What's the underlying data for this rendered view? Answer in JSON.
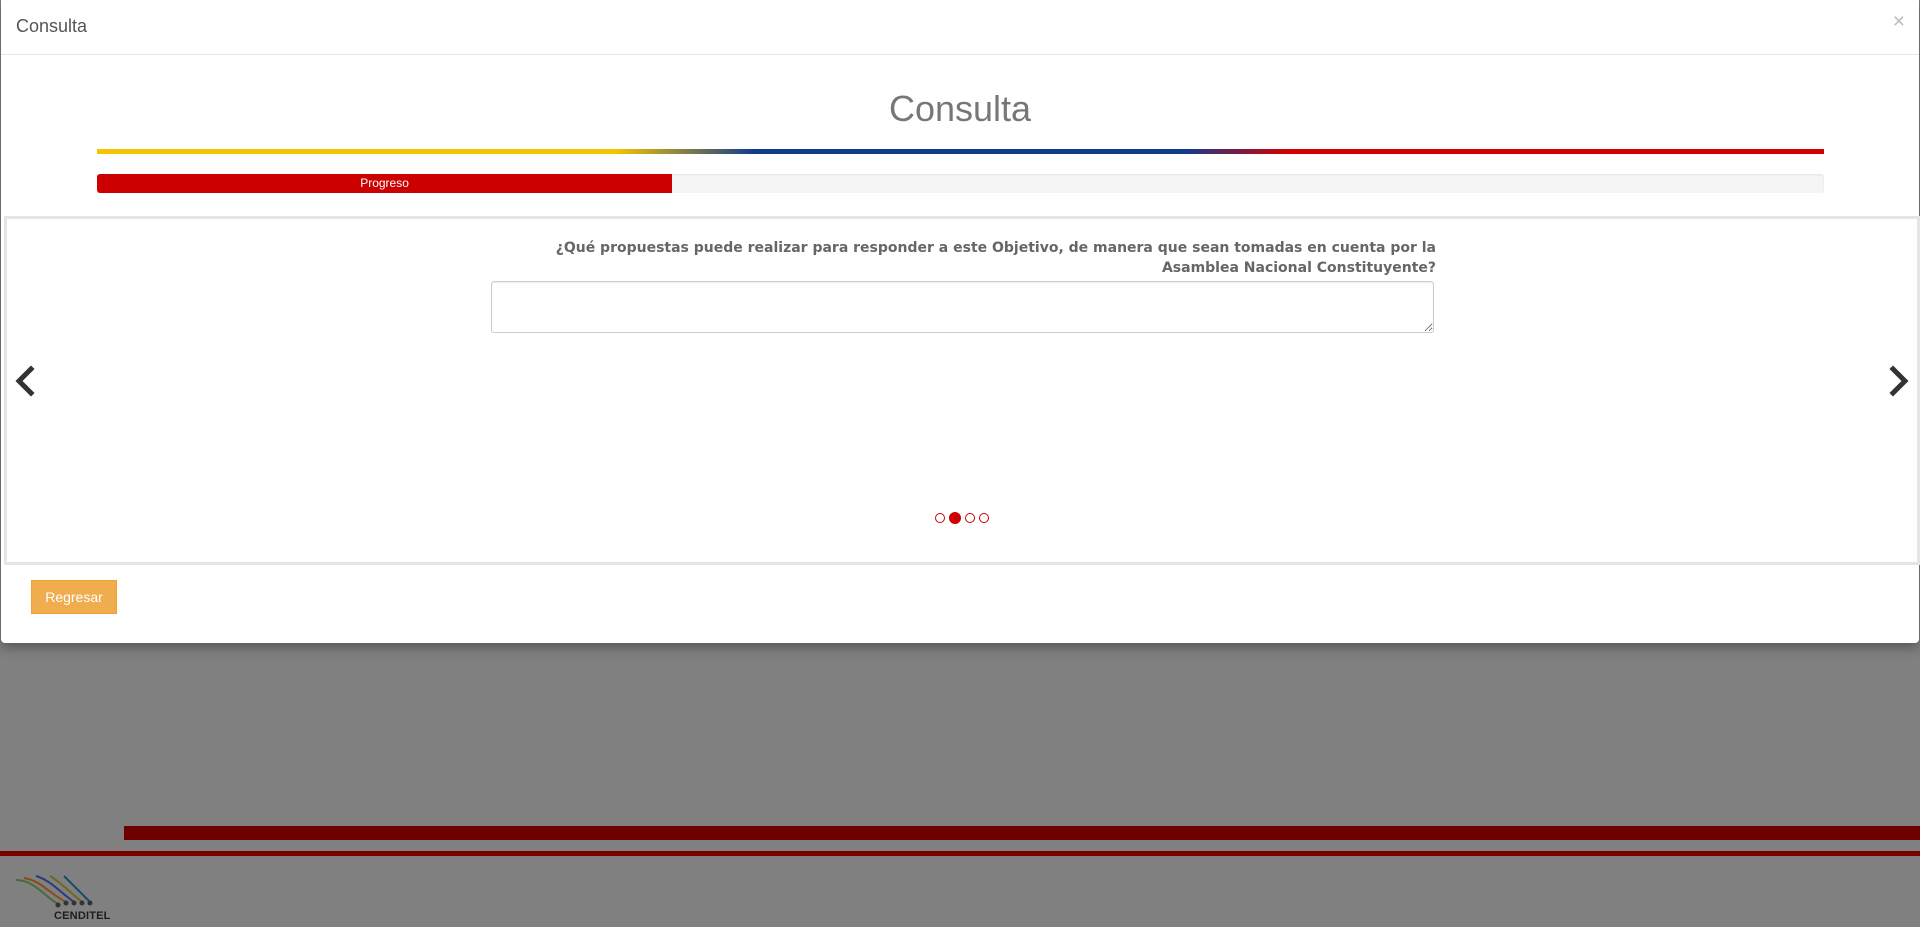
{
  "modal": {
    "header_title": "Consulta",
    "close_symbol": "×",
    "title": "Consulta",
    "progress": {
      "label": "Progreso",
      "fraction": 0.333,
      "color": "#cc0000"
    },
    "tricolor": [
      "#f4c500",
      "#133b8c",
      "#d40000"
    ]
  },
  "carousel": {
    "question": "¿Qué propuestas puede realizar para responder a este Objetivo, de manera que sean tomadas en cuenta por la Asamblea Nacional Constituyente?",
    "answer_value": "",
    "prev_icon": "chevron-left-icon",
    "next_icon": "chevron-right-icon",
    "indicators": {
      "count": 4,
      "active": 1
    }
  },
  "footer": {
    "back_label": "Regresar"
  },
  "background": {
    "logo_text": "CENDITEL"
  },
  "colors": {
    "accent": "#cc0000",
    "button": "#f0ad4e",
    "overlay": "#808080"
  }
}
